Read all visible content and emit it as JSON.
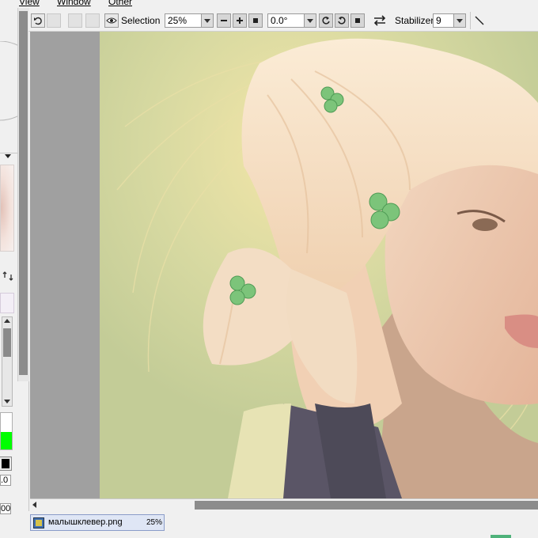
{
  "menu": {
    "view": "View",
    "window": "Window",
    "other": "Other"
  },
  "toolbar": {
    "selection_label": "Selection",
    "zoom_value": "25%",
    "angle_value": "0.0°",
    "stabilizer_label": "Stabilizer",
    "stabilizer_value": "9"
  },
  "left_panel": {
    "value_1": ".0",
    "value_2": "00"
  },
  "colors": {
    "accent_green": "#00ff00",
    "canvas_bg": "#c3cc97",
    "doc_tab_bg": "#dfe6f5"
  },
  "status": {
    "filename": "малышклевер.png",
    "zoom": "25%"
  }
}
